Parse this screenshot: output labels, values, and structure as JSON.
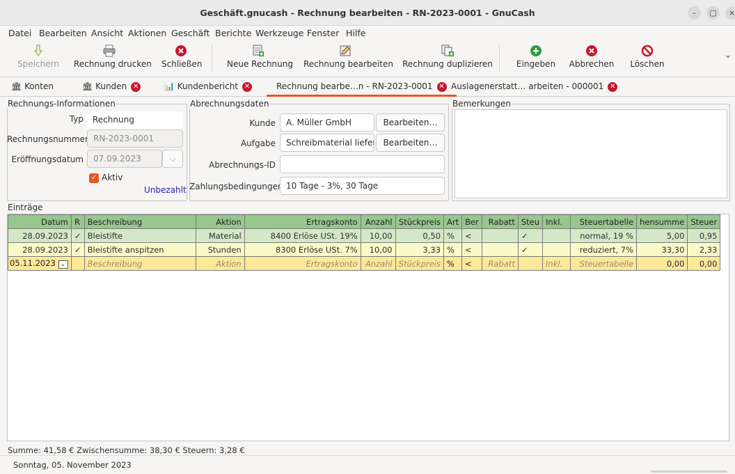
{
  "window": {
    "title": "Geschäft.gnucash - Rechnung bearbeiten - RN-2023-0001 - GnuCash",
    "min": "–",
    "max": "▢",
    "close": "×"
  },
  "menu": [
    "Datei",
    "Bearbeiten",
    "Ansicht",
    "Aktionen",
    "Geschäft",
    "Berichte",
    "Werkzeuge",
    "Fenster",
    "Hilfe"
  ],
  "toolbar": {
    "save": "Speichern",
    "print": "Rechnung drucken",
    "close": "Schließen",
    "new": "Neue Rechnung",
    "edit": "Rechnung bearbeiten",
    "dup": "Rechnung duplizieren",
    "post": "Eingeben",
    "cancel": "Abbrechen",
    "delete": "Löschen",
    "more": "⌄"
  },
  "tabs": [
    "Konten",
    "Kunden",
    "Kundenbericht",
    "Rechnung bearbe…n - RN-2023-0001",
    "Auslagenerstatt… arbeiten - 000001"
  ],
  "info": {
    "legend": "Rechnungs-Informationen",
    "type_label": "Typ",
    "type_value": "Rechnung",
    "number_label": "Rechnungsnummer",
    "number_value": "RN-2023-0001",
    "date_label": "Eröffnungsdatum",
    "date_value": "07.09.2023",
    "active_label": "Aktiv",
    "unpaid": "Unbezahlt"
  },
  "billing": {
    "legend": "Abrechnungsdaten",
    "customer_label": "Kunde",
    "customer_value": "A. Müller GmbH",
    "job_label": "Aufgabe",
    "job_value": "Schreibmaterial lieferr",
    "edit_label": "Bearbeiten…",
    "id_label": "Abrechnungs-ID",
    "id_value": "",
    "terms_label": "Zahlungsbedingungen",
    "terms_value": "10 Tage - 3%, 30 Tage"
  },
  "notes": {
    "legend": "Bemerkungen"
  },
  "entries": {
    "legend": "Einträge",
    "headers": [
      "Datum",
      "R",
      "Beschreibung",
      "Aktion",
      "Ertragskonto",
      "Anzahl",
      "Stückpreis",
      "Art",
      "Ber",
      "Rabatt",
      "Steu",
      "Inkl.",
      "Steuertabelle",
      "hensumme",
      "Steuer"
    ],
    "rows": [
      [
        "28.09.2023",
        "✓",
        "Bleistifte",
        "Material",
        "8400 Erlöse USt. 19%",
        "10,00",
        "0,50",
        "%",
        "<",
        "",
        "✓",
        "",
        "normal, 19 %",
        "5,00",
        "0,95"
      ],
      [
        "28.09.2023",
        "✓",
        "Bleistifte anspitzen",
        "Stunden",
        "8300 Erlöse USt. 7%",
        "10,00",
        "3,33",
        "%",
        "<",
        "",
        "✓",
        "",
        "reduziert, 7%",
        "33,30",
        "2,33"
      ],
      [
        "05.11.2023",
        "",
        "Beschreibung",
        "Aktion",
        "Ertragskonto",
        "Anzahl",
        "Stückpreis",
        "%",
        "<",
        "Rabatt",
        "",
        "Inkl.",
        "Steuertabelle",
        "0,00",
        "0,00"
      ]
    ]
  },
  "totals": "Summe: 41,58 €   Zwischensumme: 38,30 €   Steuern: 3,28 €",
  "statusbar": "Sonntag, 05. November 2023",
  "colors": {
    "accent": "#e95420",
    "header": "#97c78d",
    "row1": "#d4e8c8",
    "row2": "#fafac8",
    "row3": "#fde89a",
    "close_red": "#c7162b",
    "add_green": "#2e9d3a"
  }
}
